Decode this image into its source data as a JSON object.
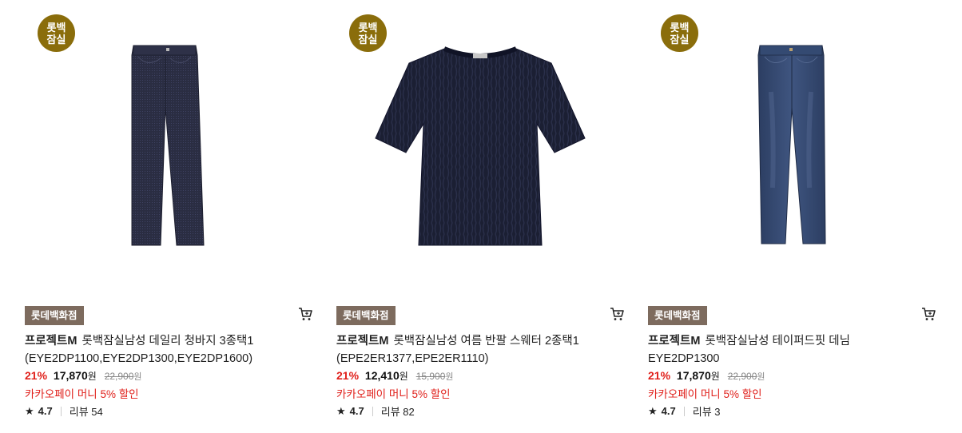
{
  "colors": {
    "store_badge": "#8a6d0b",
    "dept_badge": "#7d6b5e",
    "discount": "#e0201b"
  },
  "products": [
    {
      "store_badge": [
        "롯백",
        "잠실"
      ],
      "dept_label": "롯데백화점",
      "brand": "프로젝트M",
      "name": "롯백잠실남성 데일리 청바지 3종택1",
      "code": "(EYE2DP1100,EYE2DP1300,EYE2DP1600)",
      "discount": "21%",
      "price": "17,870",
      "price_unit": "원",
      "original_price": "22,900",
      "original_unit": "원",
      "promo": "카카오페이 머니 5% 할인",
      "rating": "4.7",
      "review_label": "리뷰 54",
      "cart_icon": "cart-icon"
    },
    {
      "store_badge": [
        "롯백",
        "잠실"
      ],
      "dept_label": "롯데백화점",
      "brand": "프로젝트M",
      "name": "롯백잠실남성 여름 반팔 스웨터 2종택1",
      "code": "(EPE2ER1377,EPE2ER1110)",
      "discount": "21%",
      "price": "12,410",
      "price_unit": "원",
      "original_price": "15,900",
      "original_unit": "원",
      "promo": "카카오페이 머니 5% 할인",
      "rating": "4.7",
      "review_label": "리뷰 82",
      "cart_icon": "cart-icon"
    },
    {
      "store_badge": [
        "롯백",
        "잠실"
      ],
      "dept_label": "롯데백화점",
      "brand": "프로젝트M",
      "name": "롯백잠실남성 테이퍼드핏 데님",
      "code": "EYE2DP1300",
      "discount": "21%",
      "price": "17,870",
      "price_unit": "원",
      "original_price": "22,900",
      "original_unit": "원",
      "promo": "카카오페이 머니 5% 할인",
      "rating": "4.7",
      "review_label": "리뷰 3",
      "cart_icon": "cart-icon"
    }
  ]
}
